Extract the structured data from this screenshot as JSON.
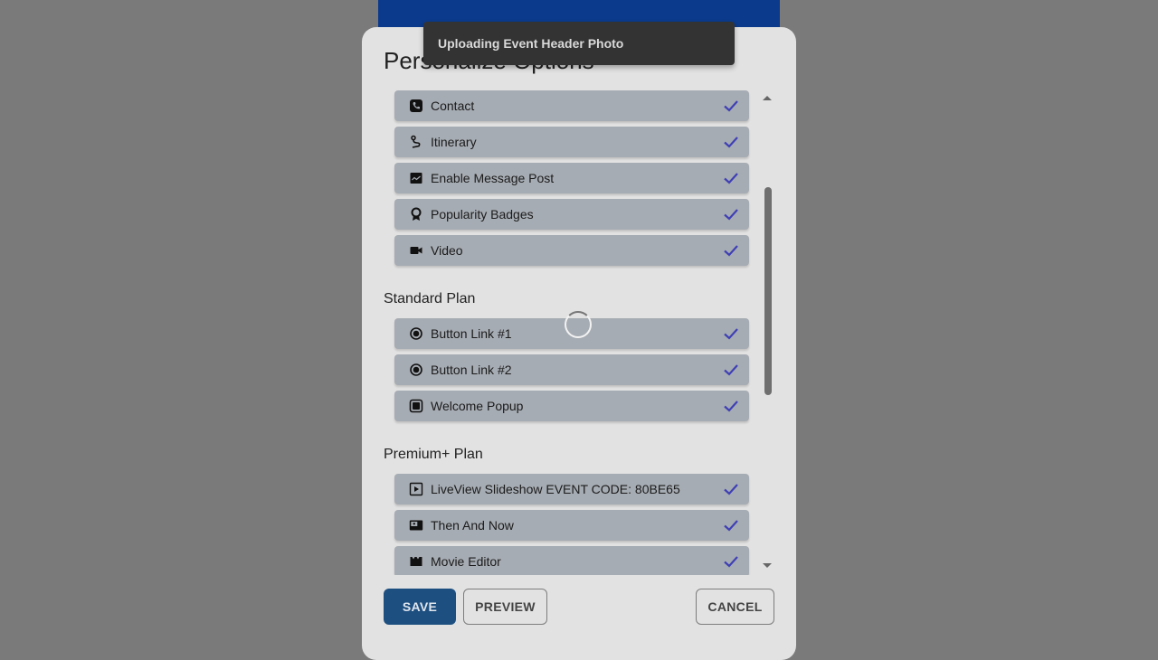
{
  "dialog": {
    "title": "Personalize Options"
  },
  "toast": {
    "message": "Uploading Event Header Photo"
  },
  "sections": {
    "top": {
      "items": [
        {
          "label": "Contact",
          "icon": "phone-icon",
          "checked": true
        },
        {
          "label": "Itinerary",
          "icon": "route-icon",
          "checked": true
        },
        {
          "label": "Enable Message Post",
          "icon": "message-image-icon",
          "checked": true
        },
        {
          "label": "Popularity Badges",
          "icon": "badge-icon",
          "checked": true
        },
        {
          "label": "Video",
          "icon": "videocam-icon",
          "checked": true
        }
      ]
    },
    "standard": {
      "heading": "Standard Plan",
      "items": [
        {
          "label": "Button Link #1",
          "icon": "radio-button-icon",
          "checked": true
        },
        {
          "label": "Button Link #2",
          "icon": "radio-button-icon",
          "checked": true
        },
        {
          "label": "Welcome Popup",
          "icon": "popup-icon",
          "checked": true
        }
      ]
    },
    "premium": {
      "heading": "Premium+ Plan",
      "items": [
        {
          "label": "LiveView Slideshow EVENT CODE: 80BE65",
          "icon": "slideshow-icon",
          "checked": true
        },
        {
          "label": "Then And Now",
          "icon": "photo-compare-icon",
          "checked": true
        },
        {
          "label": "Movie Editor",
          "icon": "movie-icon",
          "checked": true
        }
      ]
    }
  },
  "actions": {
    "save": "SAVE",
    "preview": "PREVIEW",
    "cancel": "CANCEL"
  },
  "colors": {
    "accent_check": "#3f3fb5",
    "header_blue": "#0b3a8c",
    "save_bg": "#1d4f80"
  }
}
